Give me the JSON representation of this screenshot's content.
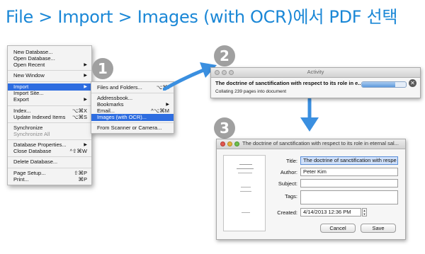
{
  "title": "File > Import > Images (with OCR)에서 PDF 선택",
  "steps": [
    "1",
    "2",
    "3"
  ],
  "file_menu": {
    "items": [
      {
        "label": "New Database..."
      },
      {
        "label": "Open Database..."
      },
      {
        "label": "Open Recent"
      },
      {
        "label": "New Window"
      },
      {
        "label": "Import"
      },
      {
        "label": "Import Site..."
      },
      {
        "label": "Export"
      },
      {
        "label": "Index...",
        "shortcut": "⌥⌘X"
      },
      {
        "label": "Update Indexed Items",
        "shortcut": "⌥⌘S"
      },
      {
        "label": "Synchronize"
      },
      {
        "label": "Synchronize All"
      },
      {
        "label": "Database Properties..."
      },
      {
        "label": "Close Database",
        "shortcut": "^⇧⌘W"
      },
      {
        "label": "Delete Database..."
      },
      {
        "label": "Page Setup...",
        "shortcut": "⇧⌘P"
      },
      {
        "label": "Print...",
        "shortcut": "⌘P"
      }
    ]
  },
  "import_submenu": {
    "items": [
      {
        "label": "Files and Folders...",
        "shortcut": "⌥⌘I"
      },
      {
        "label": "Addressbook..."
      },
      {
        "label": "Bookmarks"
      },
      {
        "label": "Email...",
        "shortcut": "^⌥⌘M"
      },
      {
        "label": "Images (with OCR)..."
      },
      {
        "label": "From Scanner or Camera..."
      }
    ]
  },
  "activity": {
    "window_title": "Activity",
    "task_title": "The doctrine of sanctification with respect to its role in e...",
    "status": "Collating 239 pages into document",
    "progress": 0.75
  },
  "dialog": {
    "window_title": "The doctrine of sanctification with respect to its role in eternal sal...",
    "labels": {
      "title": "Title:",
      "author": "Author:",
      "subject": "Subject:",
      "tags": "Tags:",
      "created": "Created:"
    },
    "values": {
      "title": "The doctrine of sanctification with respe",
      "author": "Peter Kim",
      "subject": "",
      "tags": "",
      "created": "4/14/2013 12:36 PM"
    },
    "buttons": {
      "cancel": "Cancel",
      "save": "Save"
    }
  },
  "colors": {
    "accent": "#1a87d6",
    "selection": "#2e6de0",
    "arrow": "#3a8fe0"
  }
}
